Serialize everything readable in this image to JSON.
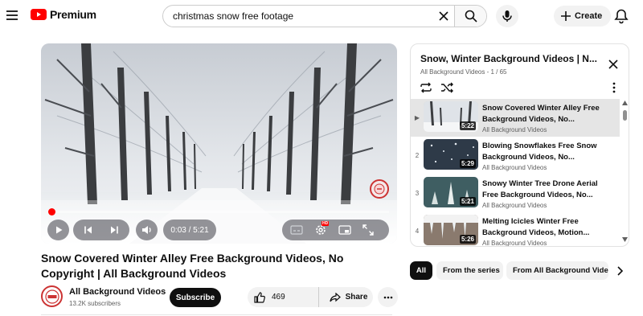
{
  "header": {
    "logo_text": "Premium",
    "search": {
      "value": "christmas snow free footage",
      "placeholder": "Search"
    },
    "create_label": "Create"
  },
  "player": {
    "current_time": "0:03",
    "separator": " / ",
    "duration": "5:21",
    "progress_fraction": 0.01,
    "hd_badge": "HD"
  },
  "video": {
    "title": "Snow Covered Winter Alley Free Background Videos, No Copyright | All Background Videos",
    "channel": "All Background Videos",
    "subscribers": "13.2K subscribers",
    "subscribe_label": "Subscribe",
    "likes": "469",
    "share_label": "Share"
  },
  "playlist": {
    "title": "Snow, Winter Background Videos | N...",
    "subtitle": "All Background Videos - 1 / 65",
    "items": [
      {
        "index": "▶",
        "title": "Snow Covered Winter Alley Free Background Videos, No...",
        "channel": "All Background Videos",
        "duration": "5:22",
        "active": true
      },
      {
        "index": "2",
        "title": "Blowing Snowflakes Free Snow Background Videos, No...",
        "channel": "All Background Videos",
        "duration": "5:29",
        "active": false
      },
      {
        "index": "3",
        "title": "Snowy Winter Tree Drone Aerial Free Background Videos, No...",
        "channel": "All Background Videos",
        "duration": "5:21",
        "active": false
      },
      {
        "index": "4",
        "title": "Melting Icicles Winter Free Background Videos, Motion...",
        "channel": "All Background Videos",
        "duration": "5:26",
        "active": false
      }
    ]
  },
  "chips": [
    "All",
    "From the series",
    "From All Background Videos"
  ],
  "colors": {
    "brand_red": "#ff0000",
    "text": "#0f0f0f",
    "muted": "#606060",
    "chip_bg": "#f2f2f2"
  }
}
